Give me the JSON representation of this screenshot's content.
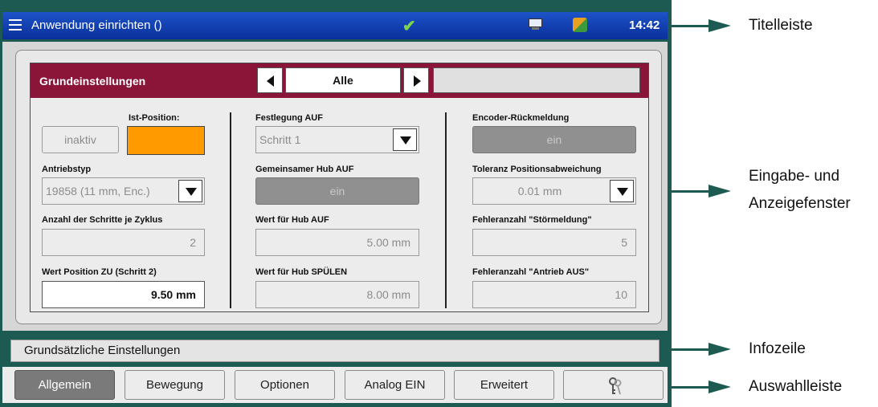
{
  "titlebar": {
    "title": "Anwendung einrichten ()",
    "clock": "14:42",
    "icons": [
      "menu-icon",
      "checkmark-icon",
      "monitor-icon",
      "apps-icon"
    ]
  },
  "card": {
    "title": "Grundeinstellungen",
    "filter_value": "Alle"
  },
  "left": {
    "ist_position_label": "Ist-Position:",
    "inaktiv_button": "inaktiv",
    "antriebstyp_label": "Antriebstyp",
    "antriebstyp_value": "19858 (11 mm, Enc.)",
    "schritte_label": "Anzahl der Schritte je Zyklus",
    "schritte_value": "2",
    "position_zu_label": "Wert Position ZU (Schritt 2)",
    "position_zu_value": "9.50 mm"
  },
  "middle": {
    "festlegung_label": "Festlegung AUF",
    "festlegung_value": "Schritt 1",
    "gemeinsamer_label": "Gemeinsamer Hub AUF",
    "gemeinsamer_value": "ein",
    "hub_auf_label": "Wert für Hub AUF",
    "hub_auf_value": "5.00 mm",
    "hub_spuelen_label": "Wert für Hub SPÜLEN",
    "hub_spuelen_value": "8.00 mm"
  },
  "right": {
    "encoder_label": "Encoder-Rückmeldung",
    "encoder_value": "ein",
    "toleranz_label": "Toleranz Positionsabweichung",
    "toleranz_value": "0.01 mm",
    "stoer_label": "Fehleranzahl \"Störmeldung\"",
    "stoer_value": "5",
    "antrieb_aus_label": "Fehleranzahl \"Antrieb AUS\"",
    "antrieb_aus_value": "10"
  },
  "infoline": "Grundsätzliche Einstellungen",
  "tabs": [
    {
      "label": "Allgemein",
      "selected": true
    },
    {
      "label": "Bewegung",
      "selected": false
    },
    {
      "label": "Optionen",
      "selected": false
    },
    {
      "label": "Analog EIN",
      "selected": false
    },
    {
      "label": "Erweitert",
      "selected": false
    },
    {
      "label": "",
      "icon": "keys-icon",
      "selected": false
    }
  ],
  "callouts": {
    "titelleiste": "Titelleiste",
    "eingabe_line1": "Eingabe- und",
    "eingabe_line2": "Anzeigefenster",
    "infozeile": "Infozeile",
    "auswahlleiste": "Auswahlleiste"
  },
  "colors": {
    "frame": "#1c5a52",
    "titlebar": "#0a2f9a",
    "card_header": "#8a1538",
    "ist_position": "#ff9a00",
    "selected_tab": "#7a7a7a"
  }
}
